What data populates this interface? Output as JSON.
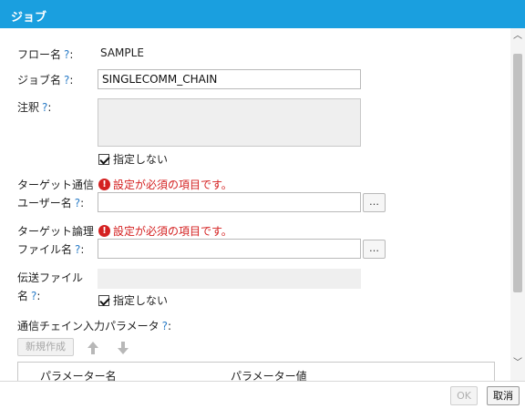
{
  "window": {
    "title": "ジョブ"
  },
  "form": {
    "flow_name": {
      "label": "フロー名",
      "help": "?",
      "colon": ":",
      "value": "SAMPLE"
    },
    "job_name": {
      "label": "ジョブ名",
      "help": "?",
      "colon": ":",
      "value": "SINGLECOMM_CHAIN"
    },
    "note": {
      "label": "注釈",
      "help": "?",
      "colon": ":",
      "unspecified_label": "指定しない",
      "unspecified_checked": true
    },
    "target_comm_user": {
      "label_line1": "ターゲット通信",
      "label_line2": "ユーザー名",
      "help": "?",
      "colon": ":",
      "error": "設定が必須の項目です。",
      "value": "",
      "browse_label": "…"
    },
    "target_logical_file": {
      "label_line1": "ターゲット論理",
      "label_line2": "ファイル名",
      "help": "?",
      "colon": ":",
      "error": "設定が必須の項目です。",
      "value": "",
      "browse_label": "…"
    },
    "transfer_file": {
      "label_line1": "伝送ファイル",
      "label_line2": "名",
      "help": "?",
      "colon": ":",
      "unspecified_label": "指定しない",
      "unspecified_checked": true
    },
    "params": {
      "label": "通信チェイン入力パラメータ",
      "help": "?",
      "colon": ":",
      "new_button": "新規作成",
      "columns": [
        "パラメーター名",
        "パラメーター値"
      ]
    }
  },
  "footer": {
    "ok_label": "OK",
    "cancel_label": "取消"
  },
  "colors": {
    "title_bar": "#1a9fdf",
    "error": "#d42020",
    "help": "#2a7cc7"
  }
}
